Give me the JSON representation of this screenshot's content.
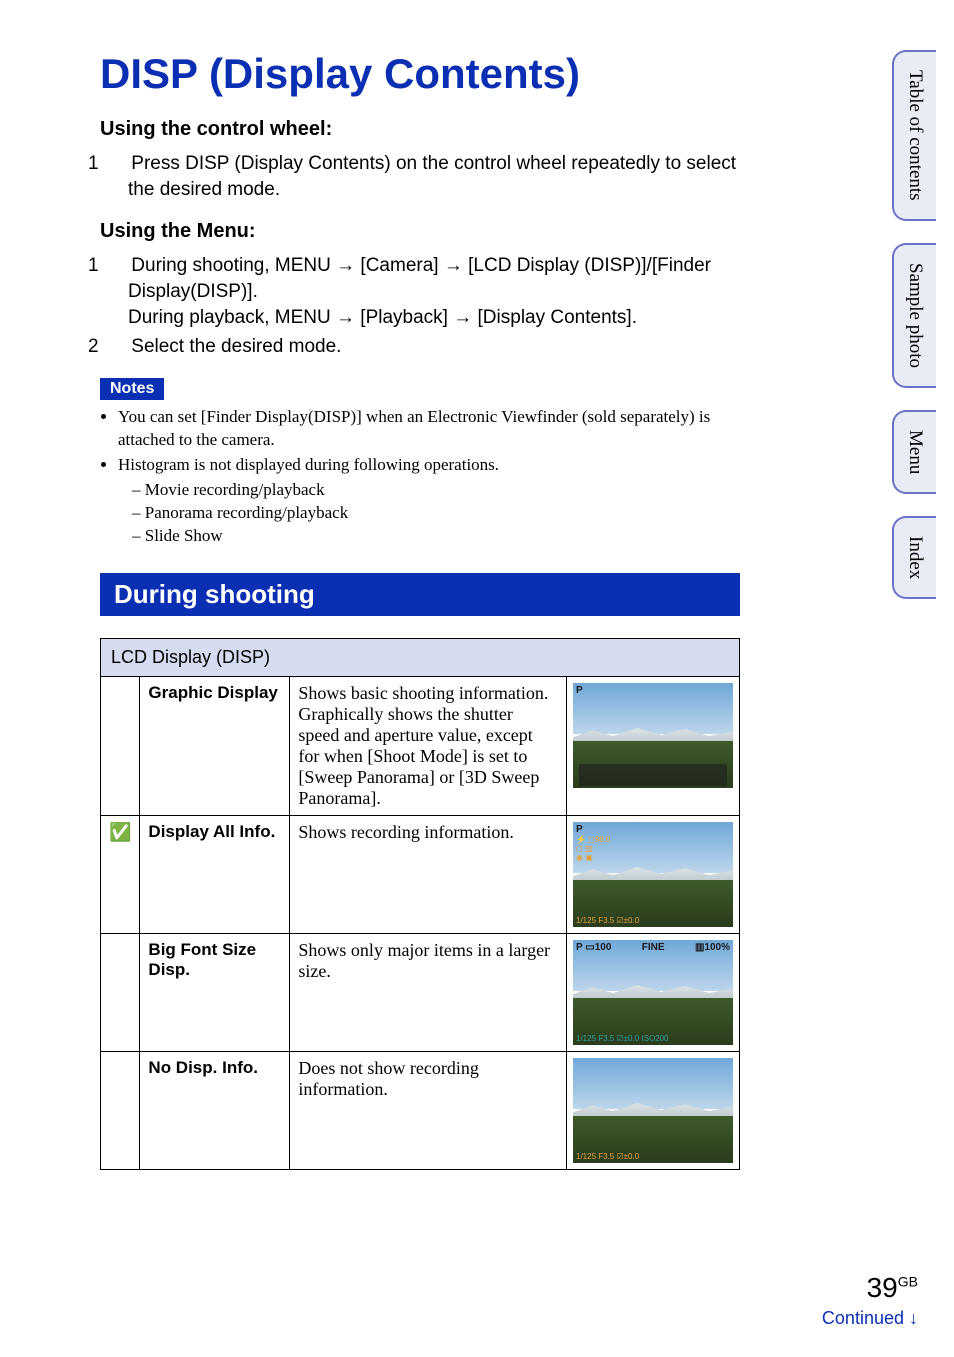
{
  "title": "DISP (Display Contents)",
  "sections": {
    "control_wheel": {
      "heading": "Using the control wheel:",
      "step1_num": "1",
      "step1_text": "Press DISP (Display Contents) on the control wheel repeatedly to select the desired mode."
    },
    "menu": {
      "heading": "Using the Menu:",
      "step1_num": "1",
      "step1_line1a": "During shooting, MENU ",
      "step1_line1b": " [Camera] ",
      "step1_line1c": " [LCD Display (DISP)]/[Finder Display(DISP)].",
      "step1_line2a": "During playback, MENU ",
      "step1_line2b": " [Playback] ",
      "step1_line2c": " [Display Contents].",
      "step2_num": "2",
      "step2_text": "Select the desired mode."
    }
  },
  "notes": {
    "badge": "Notes",
    "item1": "You can set [Finder Display(DISP)] when an Electronic Viewfinder (sold separately) is attached to the camera.",
    "item2": "Histogram is not displayed during following operations.",
    "sub1": "Movie recording/playback",
    "sub2": "Panorama recording/playback",
    "sub3": "Slide Show"
  },
  "shooting": {
    "bar": "During shooting",
    "table_header": "LCD Display (DISP)",
    "rows": [
      {
        "check": "",
        "name": "Graphic Display",
        "desc": "Shows basic shooting information. Graphically shows the shutter speed and aperture value, except for when [Shoot Mode] is set to [Sweep Panorama] or [3D Sweep Panorama].",
        "overlay": {
          "top_left": "P",
          "strip": true
        }
      },
      {
        "check": "✅",
        "name": "Display All Info.",
        "desc": "Shows recording information.",
        "overlay": {
          "top_left": "P",
          "mid_lines": "⚡ ◻98.0\n◻ ▥\n◉ ▣",
          "bottom": "1/125   F3.5  ☑±0.0"
        }
      },
      {
        "check": "",
        "name": "Big Font Size Disp.",
        "desc": "Shows only major items in a larger size.",
        "overlay": {
          "top_left": "P ▭100",
          "top_mid": "FINE",
          "top_right": "▥100%",
          "bottom_teal": "1/125   F3.5   ☑±0.0   ISO200"
        }
      },
      {
        "check": "",
        "name": "No Disp. Info.",
        "desc": "Does not show recording information.",
        "overlay": {
          "bottom": "1/125   F3.5  ☑±0.0"
        }
      }
    ]
  },
  "side_tabs": {
    "toc": "Table of contents",
    "sample": "Sample photo",
    "menu": "Menu",
    "index": "Index"
  },
  "footer": {
    "page_num": "39",
    "page_suffix": "GB",
    "continued": "Continued ↓"
  },
  "arrow": "→"
}
